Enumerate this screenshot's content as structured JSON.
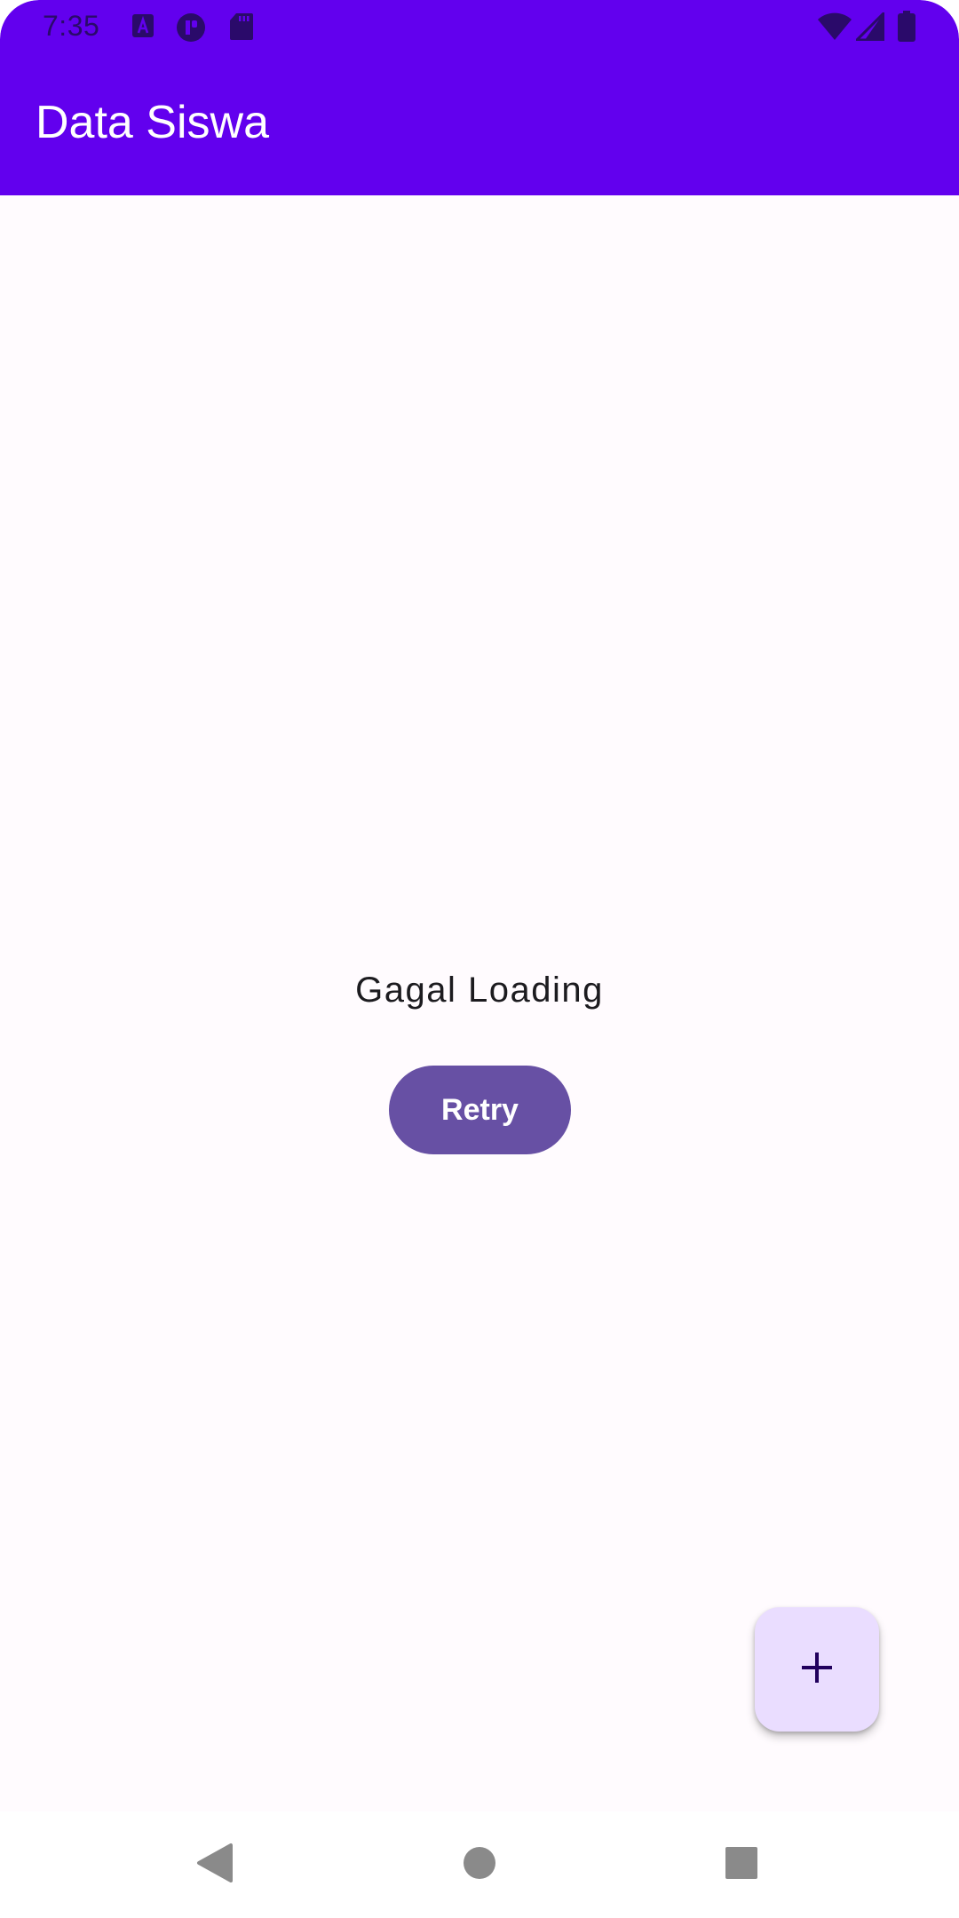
{
  "status_bar": {
    "time": "7:35",
    "left_icons": [
      "font-a-icon",
      "app-badge-icon",
      "sd-card-icon"
    ],
    "right_icons": [
      "wifi-icon",
      "cell-signal-icon",
      "battery-icon"
    ]
  },
  "app_bar": {
    "title": "Data Siswa",
    "color": "#6200ee"
  },
  "content": {
    "message": "Gagal Loading",
    "retry_label": "Retry",
    "retry_color": "#6750a4"
  },
  "fab": {
    "icon": "plus-icon",
    "color": "#eaddff"
  },
  "navigation": {
    "buttons": [
      "back-icon",
      "home-icon",
      "recents-icon"
    ]
  }
}
